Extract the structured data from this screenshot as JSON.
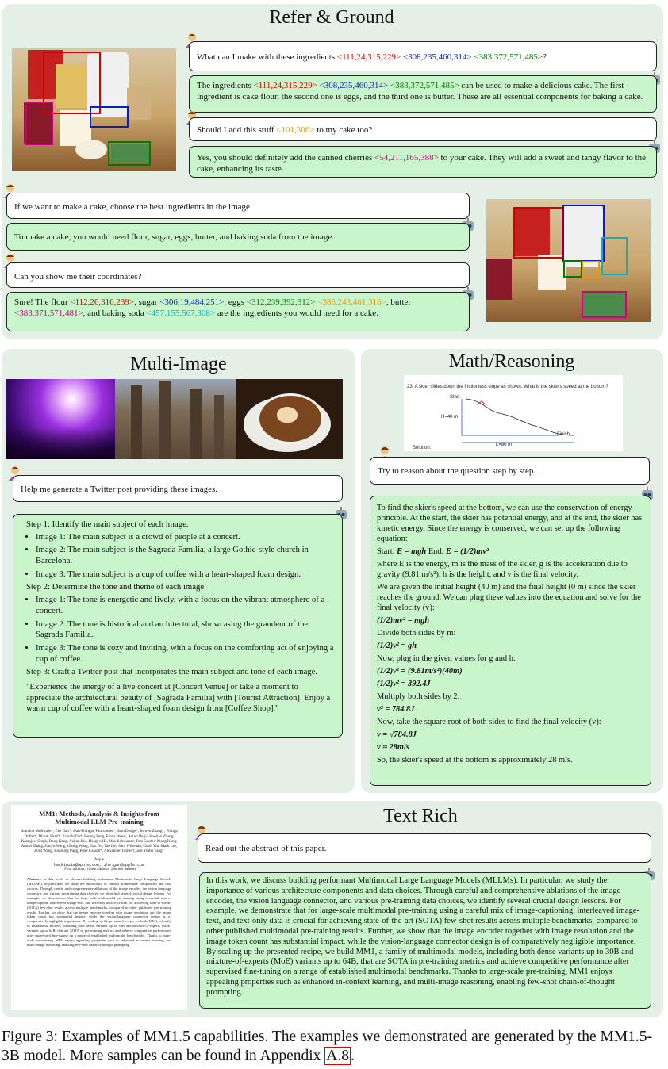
{
  "refer": {
    "title": "Refer & Ground",
    "q1": {
      "pre": "What can I make with these ingredients ",
      "c1": "<111,24,315,229>",
      "c2": "<308,235,460,314>",
      "c3": "<383,372,571,485>",
      "post": "?"
    },
    "a1": {
      "pre": "The ingredients ",
      "c1": "<111,24,315,229>",
      "c2": "<308,235,460,314>",
      "c3": "<383,372,571,485>",
      "post": " can be used to make a delicious cake. The first ingredient is cake flour, the second one is eggs, and the third one is butter. These are all essential components for baking a cake."
    },
    "q2": {
      "pre": "Should I add this stuff ",
      "c1": "<101,306>",
      "post": " to my cake too?"
    },
    "a2": {
      "pre": "Yes, you should definitely add the canned cherries ",
      "c1": "<54,211,165,388>",
      "post": " to your cake. They will add a sweet and tangy flavor to the cake, enhancing its taste."
    },
    "q3": "If we want to make a cake, choose the best ingredients in the image.",
    "a3": "To make a cake, you would need flour, sugar, eggs, butter, and baking soda from the image.",
    "q4": "Can you show me their coordinates?",
    "a4": {
      "t0": "Sure! The flour ",
      "c1": "<112,26,316,239>",
      "t1": ", sugar ",
      "c2": "<306,19,484,251>",
      "t2": ", eggs ",
      "c3": "<312,239,392,312>",
      "t3": " ",
      "c4": "<386,243,461,316>",
      "t4": ", butter ",
      "c5": "<383,371,571,481>",
      "t5": ", and baking soda ",
      "c6": "<457,155,567,308>",
      "t6": " are the ingredients you would need for a cake."
    }
  },
  "multi": {
    "title": "Multi-Image",
    "q": "Help me generate a Twitter post providing these images.",
    "step1": "Step 1: Identify the main subject of each image.",
    "s1": [
      "Image 1: The main subject is a crowd of people at a concert.",
      "Image 2: The main subject is the Sagrada Familia, a large Gothic-style church in Barcelona.",
      "Image 3: The main subject is a cup of coffee with a heart-shaped foam design."
    ],
    "step2": "Step 2: Determine the tone and theme of each image.",
    "s2": [
      "Image 1: The tone is energetic and lively, with a focus on the vibrant atmosphere of a concert.",
      "Image 2: The tone is historical and architectural, showcasing the grandeur of the Sagrada Familia.",
      "Image 3: The tone is cozy and inviting, with a focus on the comforting act of enjoying a cup of coffee."
    ],
    "step3": "Step 3: Craft a Twitter post that incorporates the main subject and tone of each image.",
    "post": "\"Experience the energy of a live concert at [Concert Venue] or take a moment to appreciate the architectural beauty of [Sagrada Familia] with [Tourist Attraction]. Enjoy a warm cup of coffee with a heart-shaped foam design from [Coffee Shop].\""
  },
  "math": {
    "title": "Math/Reasoning",
    "problem": "23. A skier slides down the frictionless slope as shown. What is the skier's speed at the bottom?",
    "lbl_start": "Start",
    "lbl_h": "H=40 m",
    "lbl_finish": "Finish",
    "lbl_l": "L=80 m",
    "lbl_solution": "Solution:",
    "q": "Try to reason about the question step by step.",
    "p1": "To find the skier's speed at the bottom, we can use the conservation of energy principle. At the start, the skier has potential energy, and at the end, the skier has kinetic energy. Since the energy is conserved, we can set up the following equation:",
    "eq_start": "Start: ",
    "eq_end": " End: ",
    "p2": "where E is the energy, m is the mass of the skier, g is the acceleration due to gravity (9.81 m/s²), h is the height, and v is the final velocity.",
    "p3": "We are given the initial height (40 m) and the final height (0 m) since the skier reaches the ground. We can plug these values into the equation and solve for the final velocity (v):",
    "e1": "(1/2)mv² = mgh",
    "divide": "Divide both sides by m:",
    "e2": "(1/2)v² = gh",
    "plug": "Now, plug in the given values for g and h:",
    "e3": "(1/2)v² = (9.81m/s²)(40m)",
    "e4": "(1/2)v² = 392.4J",
    "mult": "Multiply both sides by 2:",
    "e5": "v² = 784.8J",
    "sqrt": "Now, take the square root of both sides to find the final velocity (v):",
    "e6": "v = √784.8J",
    "e7": "v ≈ 28m/s",
    "final": "So, the skier's speed at the bottom is approximately 28 m/s."
  },
  "text_rich": {
    "title": "Text Rich",
    "paper_title": "MM1: Methods, Analysis & Insights from Multimodal LLM Pre-training",
    "paper_authors": "Brandon McKinzie*, Zhe Gan*, Jean-Philippe Fauconnier*, Sam Dodge*, Bowen Zhang*, Philipp Dufter*, Dhruti Shah*, Xianzhi Du*, Futang Peng, Floris Weers, Anton Belyi, Haotian Zhang, Karanjeet Singh, Doug Kang, Ankur Jain, Hongyu Hè, Max Schwarzer, Tom Gunter, Xiang Kong, Aonan Zhang, Jianyu Wang, Chong Wang, Nan Du, Tao Lei, Sam Wiseman, Guoli Yin, Mark Lee, Zirui Wang, Ruoming Pang, Peter Grasch*, Alexander Toshev†, and Yinfei Yang†",
    "paper_affil": "Apple",
    "paper_email": "bmckinzie@apple.com, zhe.gan@apple.com",
    "paper_note": "*First authors; †Core authors; ‡Senior authors",
    "paper_abs_label": "Abstract.",
    "paper_abs": "In this work, we discuss building performant Multimodal Large Language Models (MLLMs). In particular, we study the importance of various architecture components and data choices. Through careful and comprehensive ablations of the image encoder, the vision language connector, and various pre-training data choices, we identified several crucial design lessons. For example, we demonstrate that for large-scale multimodal pre-training using a careful mix of image-caption, interleaved image-text, and text-only data is crucial for achieving state-of-the-art (SOTA) few-shot results across multiple benchmarks, compared to other published pre-training results. Further, we show that the image encoder together with image resolution and the image token count has substantial impact, while the vision-language connector design is of comparatively negligible importance. By scaling up the presented recipe, we build MM1, a family of multimodal models, including both dense variants up to 30B and mixture-of-experts (MoE) variants up to 64B, that are SOTA in pre-training metrics and achieve competitive performance after supervised fine-tuning on a range of established multimodal benchmarks. Thanks to large-scale pre-training, MM1 enjoys appealing properties such as enhanced in-context learning, and multi-image reasoning, enabling few-shot chain-of-thought prompting.",
    "q": "Read out the abstract of this paper.",
    "a": "In this work, we discuss building performant Multimodal Large Language Models (MLLMs). In particular, we study the importance of various architecture components and data choices. Through careful and comprehensive ablations of the image encoder, the vision language connector, and various pre-training data choices, we identify several crucial design lessons. For example, we demonstrate that for large-scale multimodal pre-training using a careful mix of image-captioning, interleaved image-text, and text-only data is crucial for achieving state-of-the-art (SOTA) few-shot results across multiple benchmarks, compared to other published multimodal pre-training results. Further, we show that the image encoder together with image resolution and the image token count has substantial impact, while the vision-language connector design is of comparatively negligible importance. By scaling up the presented recipe, we build MM1, a family of multimodal models, including both dense variants up to 30B and mixture-of-experts (MoE) variants up to 64B, that are SOTA in pre-training metrics and achieve competitive performance after supervised fine-tuning on a range of established multimodal benchmarks. Thanks to large-scale pre-training, MM1 enjoys appealing properties such as enhanced in-context learning, and multi-image reasoning, enabling few-shot chain-of-thought prompting."
  },
  "caption": {
    "pre": "Figure 3: Examples of MM1.5 capabilities. The examples we demonstrated are generated by the MM1.5-3B model. More samples can be found in Appendix ",
    "ref": "A.8",
    "post": "."
  }
}
